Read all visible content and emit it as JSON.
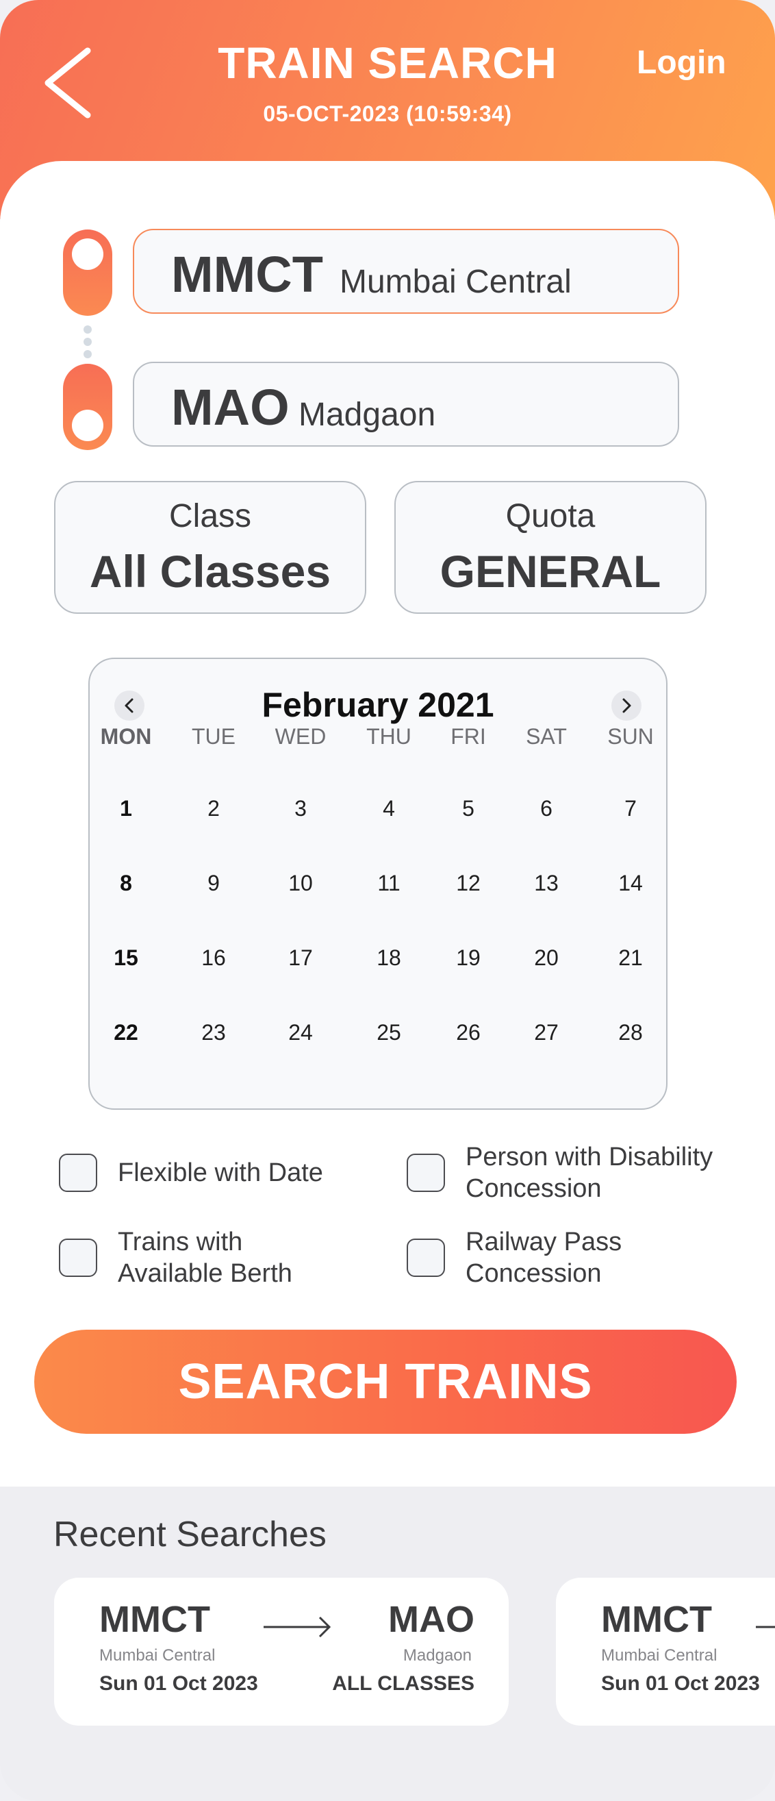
{
  "header": {
    "title": "TRAIN SEARCH",
    "datetime": "05-OCT-2023 (10:59:34)",
    "login_label": "Login",
    "back_icon": "chevron-left-icon"
  },
  "from_station": {
    "code": "MMCT",
    "name": "Mumbai Central"
  },
  "to_station": {
    "code": "MAO",
    "name": "Madgaon"
  },
  "class_picker": {
    "label": "Class",
    "value": "All Classes"
  },
  "quota_picker": {
    "label": "Quota",
    "value": "GENERAL"
  },
  "calendar": {
    "month_label": "February 2021",
    "weekdays": [
      "MON",
      "TUE",
      "WED",
      "THU",
      "FRI",
      "SAT",
      "SUN"
    ],
    "weeks": [
      [
        "1",
        "2",
        "3",
        "4",
        "5",
        "6",
        "7"
      ],
      [
        "8",
        "9",
        "10",
        "11",
        "12",
        "13",
        "14"
      ],
      [
        "15",
        "16",
        "17",
        "18",
        "19",
        "20",
        "21"
      ],
      [
        "22",
        "23",
        "24",
        "25",
        "26",
        "27",
        "28"
      ]
    ]
  },
  "options": {
    "flexible_date": {
      "label": "Flexible with Date",
      "checked": false
    },
    "disability": {
      "line1": "Person with Disability",
      "line2": "Concession",
      "checked": false
    },
    "available_berth": {
      "line1": "Trains with",
      "line2": "Available Berth",
      "checked": false
    },
    "railway_pass": {
      "line1": "Railway Pass",
      "line2": "Concession",
      "checked": false
    }
  },
  "search_button_label": "SEARCH TRAINS",
  "recent": {
    "title": "Recent Searches",
    "items": [
      {
        "from_code": "MMCT",
        "from_name": "Mumbai Central",
        "to_code": "MAO",
        "to_name": "Madgaon",
        "date": "Sun 01 Oct 2023",
        "class": "ALL CLASSES"
      },
      {
        "from_code": "MMCT",
        "from_name": "Mumbai Central",
        "date": "Sun 01 Oct 2023"
      }
    ]
  },
  "colors": {
    "accent_start": "#f76e55",
    "accent_end": "#fea24c",
    "text_dark": "#3c3c3e"
  }
}
